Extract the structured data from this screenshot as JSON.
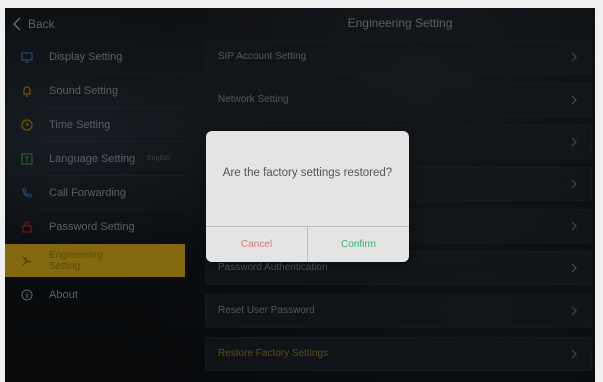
{
  "header": {
    "back_label": "Back",
    "title": "Engineering Setting"
  },
  "sidebar": {
    "items": [
      {
        "label": "Display Setting",
        "icon": "monitor-icon"
      },
      {
        "label": "Sound Setting",
        "icon": "bell-icon"
      },
      {
        "label": "Time Setting",
        "icon": "clock-icon"
      },
      {
        "label": "Language Setting",
        "icon": "language-icon",
        "value": "English"
      },
      {
        "label": "Call Forwarding",
        "icon": "call-forward-icon"
      },
      {
        "label": "Password Setting",
        "icon": "lock-icon"
      },
      {
        "label": "Engineering Setting",
        "icon": "tools-icon",
        "active": true
      },
      {
        "label": "About",
        "icon": "info-icon"
      }
    ]
  },
  "list": {
    "items": [
      {
        "label": "SIP Account Setting"
      },
      {
        "label": "Network Setting"
      },
      {
        "label": ""
      },
      {
        "label": ""
      },
      {
        "label": ""
      },
      {
        "label": "Password Authentication"
      },
      {
        "label": "Reset User Password"
      },
      {
        "label": "Restore Factory Settings",
        "highlight": true
      }
    ]
  },
  "dialog": {
    "message": "Are the factory settings restored?",
    "cancel_label": "Cancel",
    "confirm_label": "Confirm"
  },
  "colors": {
    "accent": "#caa015",
    "cancel": "#d97a7a",
    "confirm": "#3bb06a"
  }
}
